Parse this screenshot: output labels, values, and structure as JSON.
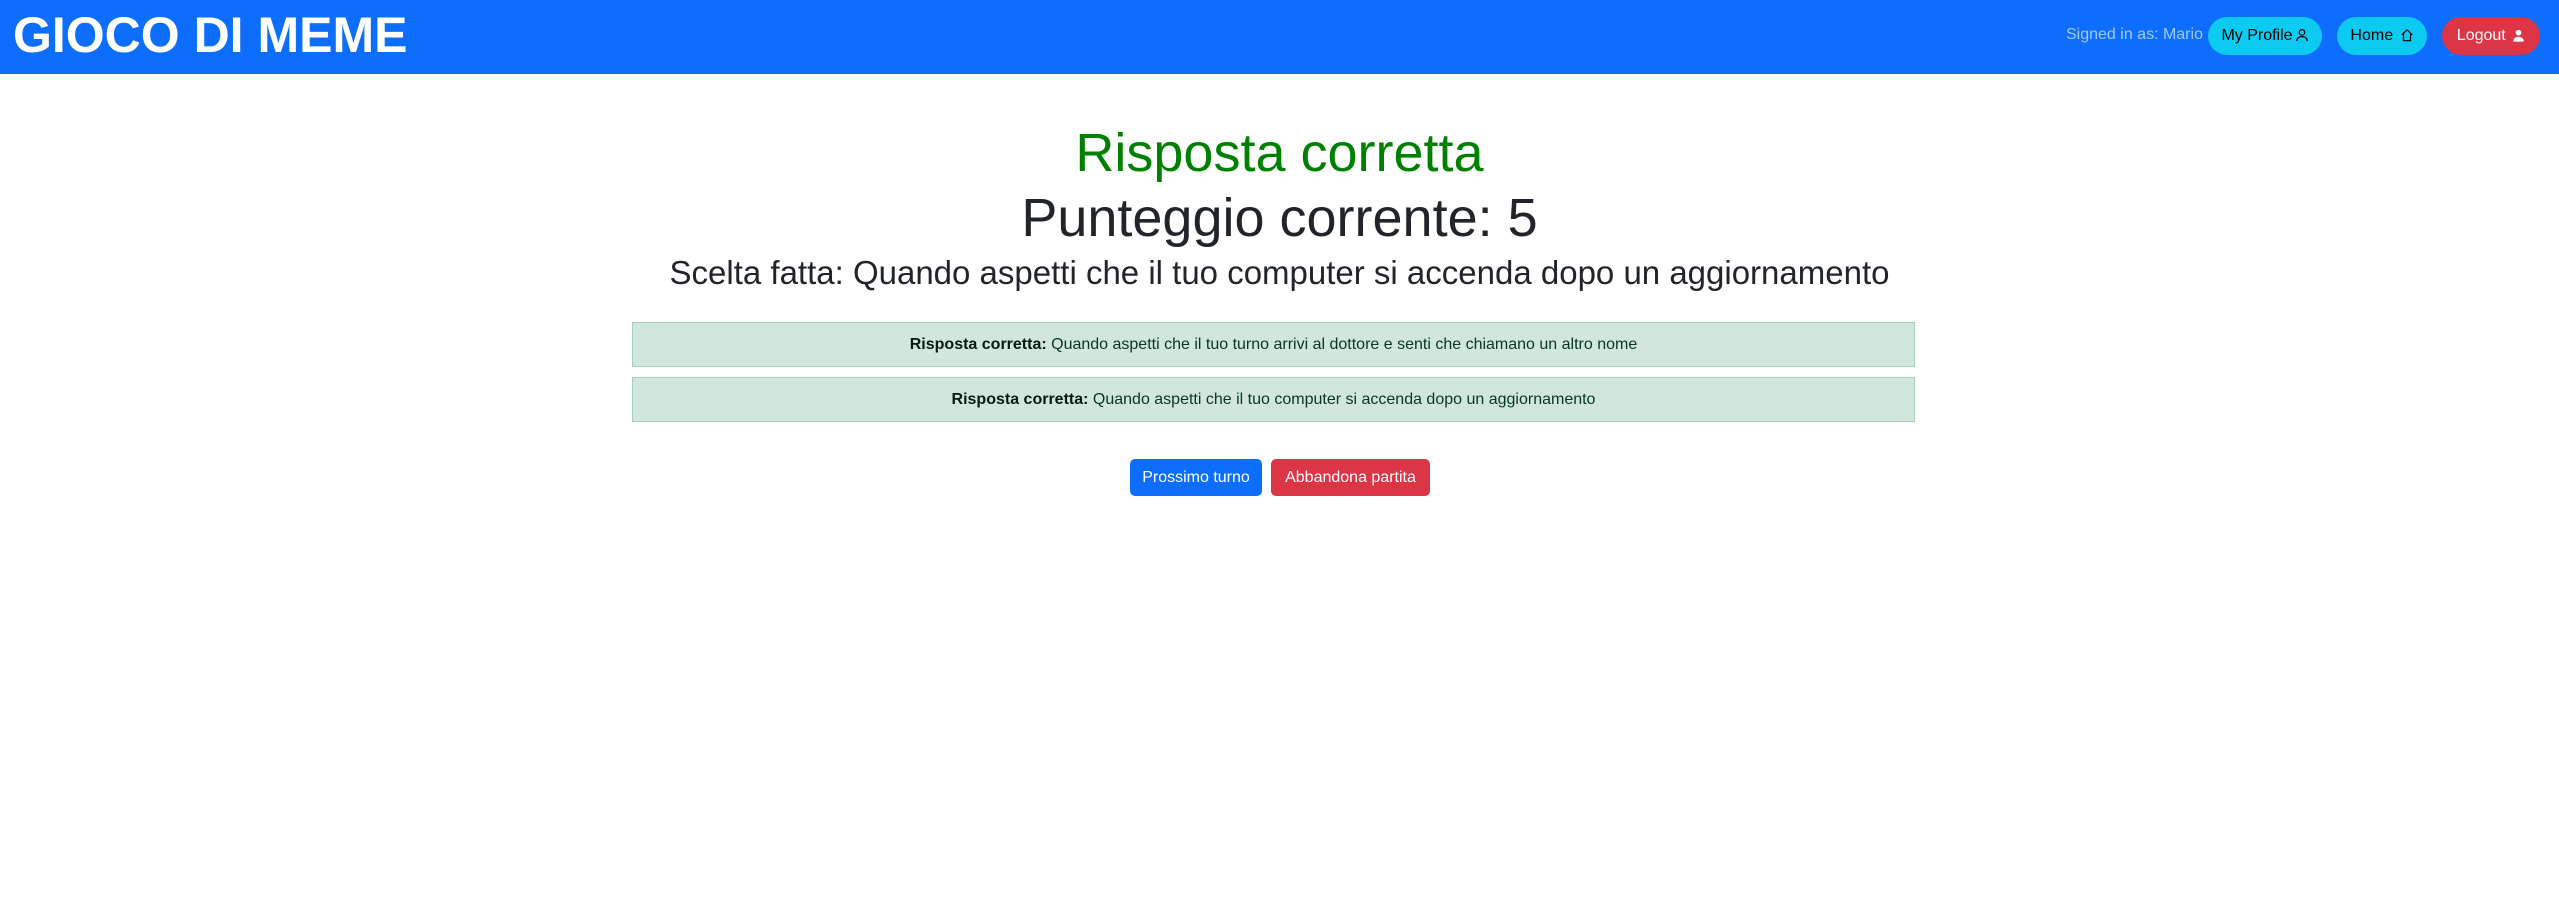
{
  "navbar": {
    "brand": "GIOCO DI MEME",
    "signed_in": "Signed in as: Mario",
    "profile_label": "My Profile",
    "home_label": "Home",
    "logout_label": "Logout",
    "accent_color": "#0d6efd"
  },
  "result": {
    "title": "Risposta corretta",
    "title_color": "#008000",
    "score_label": "Punteggio corrente: 5",
    "choice_label": "Scelta fatta: Quando aspetti che il tuo computer si accenda dopo un aggiornamento"
  },
  "answers": [
    {
      "label": "Risposta corretta:",
      "text": " Quando aspetti che il tuo turno arrivi al dottore e senti che chiamano un altro nome"
    },
    {
      "label": "Risposta corretta:",
      "text": " Quando aspetti che il tuo computer si accenda dopo un aggiornamento"
    }
  ],
  "actions": {
    "next_label": "Prossimo turno",
    "quit_label": "Abbandona partita"
  },
  "icons": {
    "profile": "person-outline-icon",
    "home": "house-outline-icon",
    "logout": "person-fill-icon"
  }
}
